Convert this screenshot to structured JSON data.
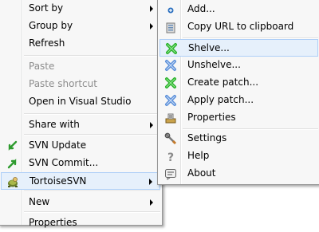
{
  "main_menu": {
    "sort_by": "Sort by",
    "group_by": "Group by",
    "refresh": "Refresh",
    "paste": "Paste",
    "paste_shortcut": "Paste shortcut",
    "open_vs": "Open in Visual Studio",
    "share_with": "Share with",
    "svn_update": "SVN Update",
    "svn_commit": "SVN Commit...",
    "tortoise": "TortoiseSVN",
    "new": "New",
    "properties": "Properties"
  },
  "submenu": {
    "add": "Add...",
    "copy_url": "Copy URL to clipboard",
    "shelve": "Shelve...",
    "unshelve": "Unshelve...",
    "create_patch": "Create patch...",
    "apply_patch": "Apply patch...",
    "properties": "Properties",
    "settings": "Settings",
    "help": "Help",
    "about": "About"
  },
  "colors": {
    "highlight_bg": "#e6f0fb",
    "highlight_border": "#aecff7",
    "disabled_text": "#8d8d8d"
  }
}
